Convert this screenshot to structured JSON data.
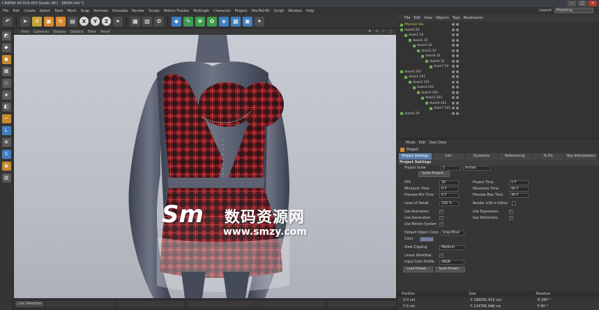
{
  "window": {
    "title": "CINEMA 4D R16.050 Studio (RC) - [BODY.c4d *]",
    "btn_min": "–",
    "btn_max": "□",
    "btn_close": "×"
  },
  "menubar": {
    "items": [
      "File",
      "Edit",
      "Create",
      "Select",
      "Tools",
      "Mesh",
      "Snap",
      "Animate",
      "Simulate",
      "Render",
      "Sculpt",
      "Motion Tracker",
      "MoGraph",
      "Character",
      "Plugins",
      "MaxToC4D",
      "Script",
      "Window",
      "Help"
    ],
    "layout_label": "Layout:",
    "layout_value": "Modeling"
  },
  "toolbar": {
    "undo_icon": "↶",
    "axis_x": "X",
    "axis_y": "Y",
    "axis_z": "Z"
  },
  "viewport": {
    "menu": [
      "View",
      "Cameras",
      "Display",
      "Options",
      "Filter",
      "Panel"
    ],
    "nav_icons": "✥ ⟲ ⤢ ▢",
    "watermark_logo": "Sm",
    "watermark_cn": "数码资源网",
    "watermark_url": "www.smzy.com"
  },
  "bottombar": {
    "live_selection": "Live Selection"
  },
  "objects": {
    "tabs": [
      "File",
      "Edit",
      "View",
      "Objects",
      "Tags",
      "Bookmarks"
    ],
    "rows": [
      {
        "name": "Physical Sky",
        "indent": 0,
        "state": "hl"
      },
      {
        "name": "duan0.20",
        "indent": 0,
        "state": ""
      },
      {
        "name": "duan1.10",
        "indent": 1,
        "state": ""
      },
      {
        "name": "duan1.10",
        "indent": 2,
        "state": ""
      },
      {
        "name": "duan4.10",
        "indent": 3,
        "state": ""
      },
      {
        "name": "duan5.10",
        "indent": 4,
        "state": ""
      },
      {
        "name": "duan6.10",
        "indent": 5,
        "state": ""
      },
      {
        "name": "duan6.10",
        "indent": 6,
        "state": ""
      },
      {
        "name": "duan7.10",
        "indent": 7,
        "state": ""
      },
      {
        "name": "duan0.101",
        "indent": 0,
        "state": ""
      },
      {
        "name": "duan1.101",
        "indent": 1,
        "state": ""
      },
      {
        "name": "duan2.101",
        "indent": 2,
        "state": ""
      },
      {
        "name": "duan3.101",
        "indent": 3,
        "state": ""
      },
      {
        "name": "duan4.101",
        "indent": 4,
        "state": ""
      },
      {
        "name": "duan5.101",
        "indent": 5,
        "state": ""
      },
      {
        "name": "duan6.101",
        "indent": 6,
        "state": ""
      },
      {
        "name": "duan7.101",
        "indent": 7,
        "state": ""
      },
      {
        "name": "duan0.19",
        "indent": 0,
        "state": ""
      }
    ]
  },
  "attributes": {
    "menu": [
      "Mode",
      "Edit",
      "User Data"
    ],
    "title": "Project",
    "tabs": [
      "Project Settings",
      "Info",
      "Dynamics",
      "Referencing",
      "To Do",
      "Key Interpolation"
    ],
    "section": "Project Settings",
    "project_scale_label": "Project Scale",
    "project_scale_value": "1",
    "project_scale_unit": "Inches",
    "scale_project_btn": "Scale Project...",
    "fps_label": "FPS",
    "fps_value": "30",
    "project_time_label": "Project Time",
    "project_time_value": "0 F",
    "min_time_label": "Minimum Time",
    "min_time_value": "0 F",
    "max_time_label": "Maximum Time",
    "max_time_value": "90 F",
    "preview_min_label": "Preview Min Time",
    "preview_min_value": "0 F",
    "preview_max_label": "Preview Max Time",
    "preview_max_value": "90 F",
    "lod_label": "Level of Detail",
    "lod_value": "100 %",
    "render_lod_label": "Render LOD in Editor",
    "use_animation_label": "Use Animation",
    "use_expression_label": "Use Expression",
    "use_generators_label": "Use Generators",
    "use_deformers_label": "Use Deformers",
    "use_motion_label": "Use Motion System",
    "default_color_label": "Default Object Color",
    "default_color_value": "Gray-Blue",
    "color_label": "Color",
    "view_clipping_label": "View Clipping",
    "view_clipping_value": "Medium",
    "linear_workflow_label": "Linear Workflow",
    "input_profile_label": "Input Color Profile",
    "input_profile_value": "sRGB",
    "load_preset_btn": "Load Preset...",
    "save_preset_btn": "Save Preset...",
    "check": "✓"
  },
  "coordinates": {
    "headers": [
      "Position",
      "Size",
      "Rotation"
    ],
    "rows": [
      [
        "X  0 cm",
        "X  189291.415 cm",
        "H  180 °"
      ],
      [
        "Y  0 cm",
        "Y  134765.948 cm",
        "P  90 °"
      ]
    ]
  },
  "colors": {
    "accent": "#5a7fa8",
    "highlight": "#e1c86a",
    "swatch": "#6f7fa3"
  }
}
